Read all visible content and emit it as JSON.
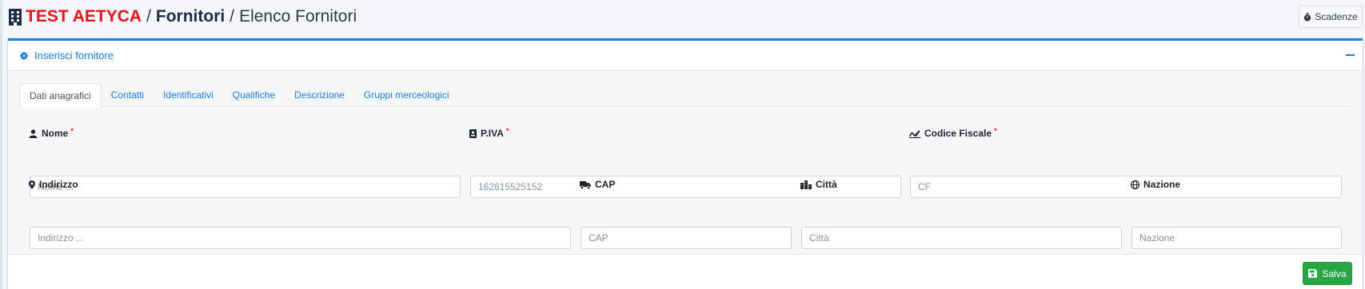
{
  "header": {
    "brand": "TEST AETYCA",
    "separator1": "/",
    "section": "Fornitori",
    "separator2": "/",
    "page": "Elenco Fornitori",
    "icon": "building-icon"
  },
  "toolbar": {
    "scadenze_label": "Scadenze",
    "scadenze_icon": "stopwatch-icon"
  },
  "card": {
    "title": "Inserisci fornitore",
    "title_icon": "gear-icon",
    "collapse_icon": "minus-icon",
    "accent_color": "#1d83e3"
  },
  "tabs": [
    {
      "label": "Dati anagrafici",
      "active": true
    },
    {
      "label": "Contatti",
      "active": false
    },
    {
      "label": "Identificativi",
      "active": false
    },
    {
      "label": "Qualifiche",
      "active": false
    },
    {
      "label": "Descrizione",
      "active": false
    },
    {
      "label": "Gruppi merceologici",
      "active": false
    }
  ],
  "fields": {
    "nome": {
      "label": "Nome",
      "required": "*",
      "placeholder": "Nome ...",
      "value": "",
      "icon": "user-icon"
    },
    "piva": {
      "label": "P.IVA",
      "required": "*",
      "placeholder": "162615525152",
      "value": "",
      "icon": "id-card-icon"
    },
    "cf": {
      "label": "Codice Fiscale",
      "required": "*",
      "placeholder": "CF",
      "value": "",
      "icon": "signature-icon"
    },
    "indirizzo": {
      "label": "Indirizzo",
      "placeholder": "Indirizzo ...",
      "value": "",
      "icon": "map-marker-icon"
    },
    "cap": {
      "label": "CAP",
      "placeholder": "CAP",
      "value": "",
      "icon": "shipping-truck-icon"
    },
    "citta": {
      "label": "Città",
      "placeholder": "Città",
      "value": "",
      "icon": "city-icon"
    },
    "nazione": {
      "label": "Nazione",
      "placeholder": "Nazione",
      "value": "",
      "icon": "globe-icon"
    }
  },
  "footer": {
    "save_label": "Salva",
    "save_icon": "floppy-disk-icon",
    "save_color": "#28a745"
  },
  "colors": {
    "brand_red": "#e3151b",
    "link_blue": "#1d7be0",
    "required_red": "#e3151b"
  }
}
